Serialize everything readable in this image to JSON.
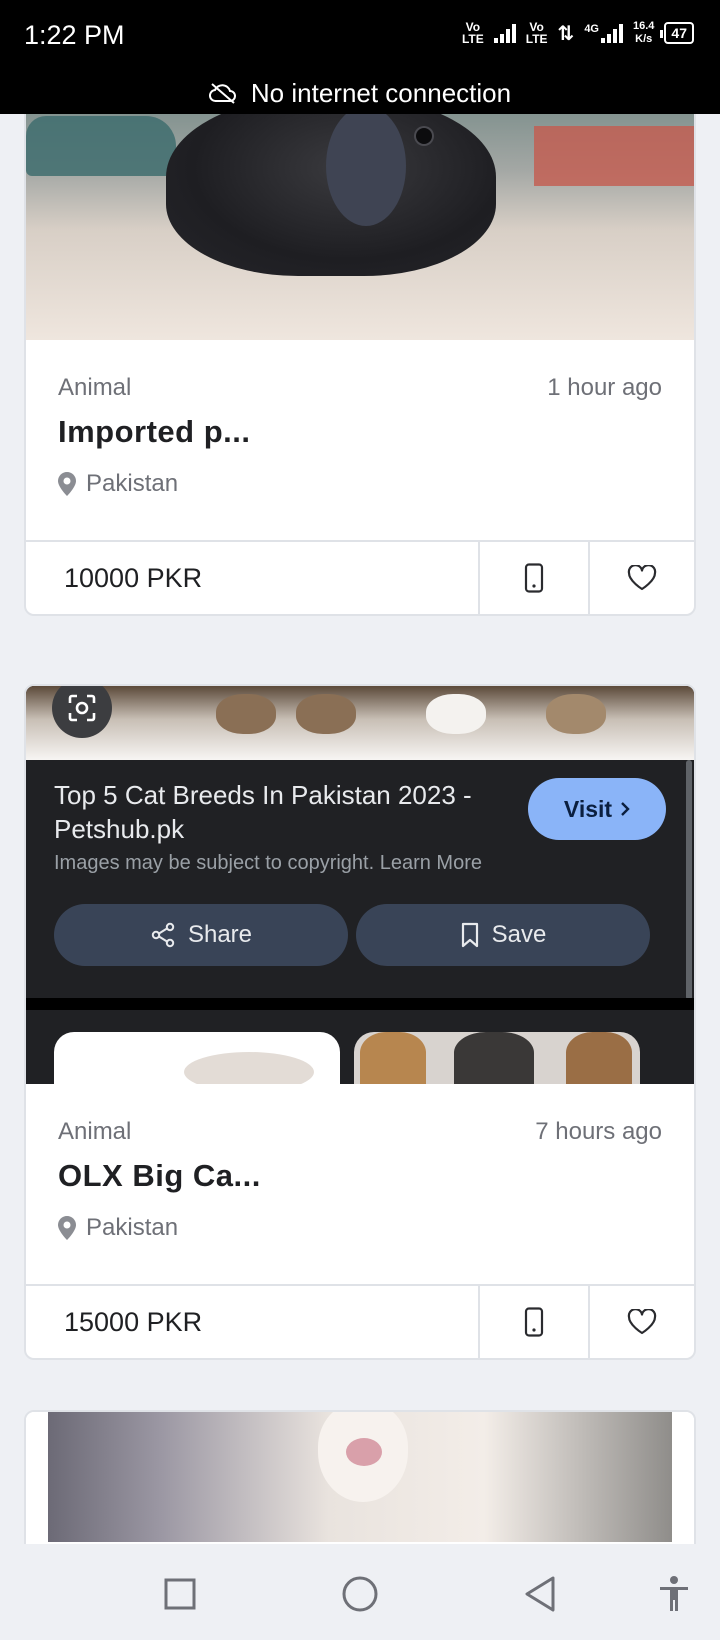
{
  "status_bar": {
    "time": "1:22 PM",
    "volte1": [
      "Vo",
      "LTE"
    ],
    "volte2": [
      "Vo",
      "LTE"
    ],
    "network": "4G",
    "speed_value": "16.4",
    "speed_unit": "K/s",
    "battery": "47"
  },
  "connection_banner": {
    "text": "No internet connection",
    "icon": "cloud-off-icon"
  },
  "listings": [
    {
      "category": "Animal",
      "time_ago": "1 hour ago",
      "title": "Imported p...",
      "location": "Pakistan",
      "price": "10000 PKR"
    },
    {
      "category": "Animal",
      "time_ago": "7 hours ago",
      "title": "OLX Big Ca...",
      "location": "Pakistan",
      "price": "15000 PKR"
    }
  ],
  "ad_overlay": {
    "title": "Top 5 Cat Breeds In Pakistan 2023 - Petshub.pk",
    "visit_label": "Visit",
    "copyright_note": "Images may be subject to copyright. Learn More",
    "share_label": "Share",
    "save_label": "Save"
  },
  "colors": {
    "accent_blue": "#8ab4f8",
    "ad_background": "#202124",
    "ad_button": "#394457",
    "page_background": "#eef0f4"
  },
  "nav_bar": {
    "icons": [
      "recents-square-icon",
      "home-circle-icon",
      "back-triangle-icon",
      "accessibility-icon"
    ]
  }
}
